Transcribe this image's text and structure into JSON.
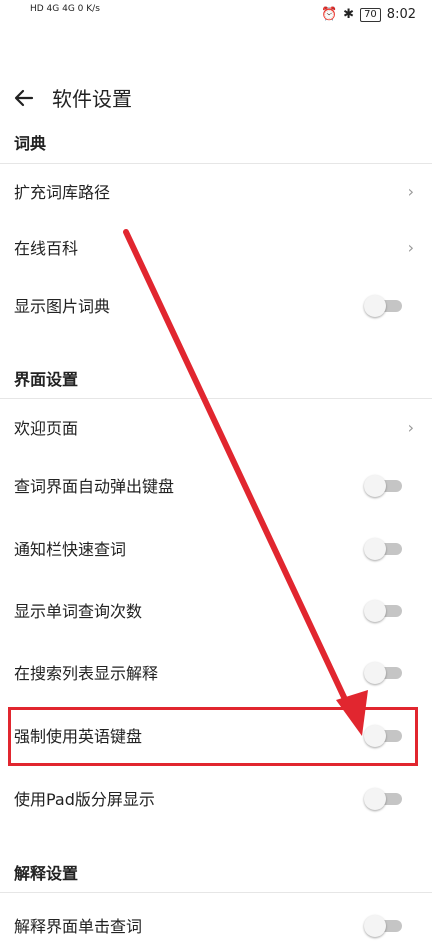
{
  "status_bar": {
    "left_text": "HD 4G 4G 0 K/s",
    "time": "8:02",
    "battery": "70",
    "icons": [
      "signal-icon",
      "wifi-icon",
      "alarm-icon",
      "bluetooth-icon",
      "battery-icon"
    ]
  },
  "app_bar": {
    "title": "软件设置",
    "back_icon": "back-arrow-icon"
  },
  "sections": {
    "dictionary": {
      "title": "词典"
    },
    "interface": {
      "title": "界面设置"
    },
    "explanation": {
      "title": "解释设置"
    }
  },
  "rows": {
    "expand_path": {
      "label": "扩充词库路径"
    },
    "online_wiki": {
      "label": "在线百科"
    },
    "show_image_dict": {
      "label": "显示图片词典",
      "enabled": false
    },
    "welcome_page": {
      "label": "欢迎页面"
    },
    "auto_keyboard": {
      "label": "查词界面自动弹出键盘",
      "enabled": false
    },
    "notify_lookup": {
      "label": "通知栏快速查词",
      "enabled": false
    },
    "show_count": {
      "label": "显示单词查询次数",
      "enabled": false
    },
    "show_explain": {
      "label": "在搜索列表显示解释",
      "enabled": false
    },
    "force_english_kb": {
      "label": "强制使用英语键盘",
      "enabled": false
    },
    "pad_split": {
      "label": "使用Pad版分屏显示",
      "enabled": false
    },
    "tap_lookup": {
      "label": "解释界面单击查词",
      "enabled": false
    }
  },
  "annotation": {
    "highlight_color": "#e1262f"
  }
}
